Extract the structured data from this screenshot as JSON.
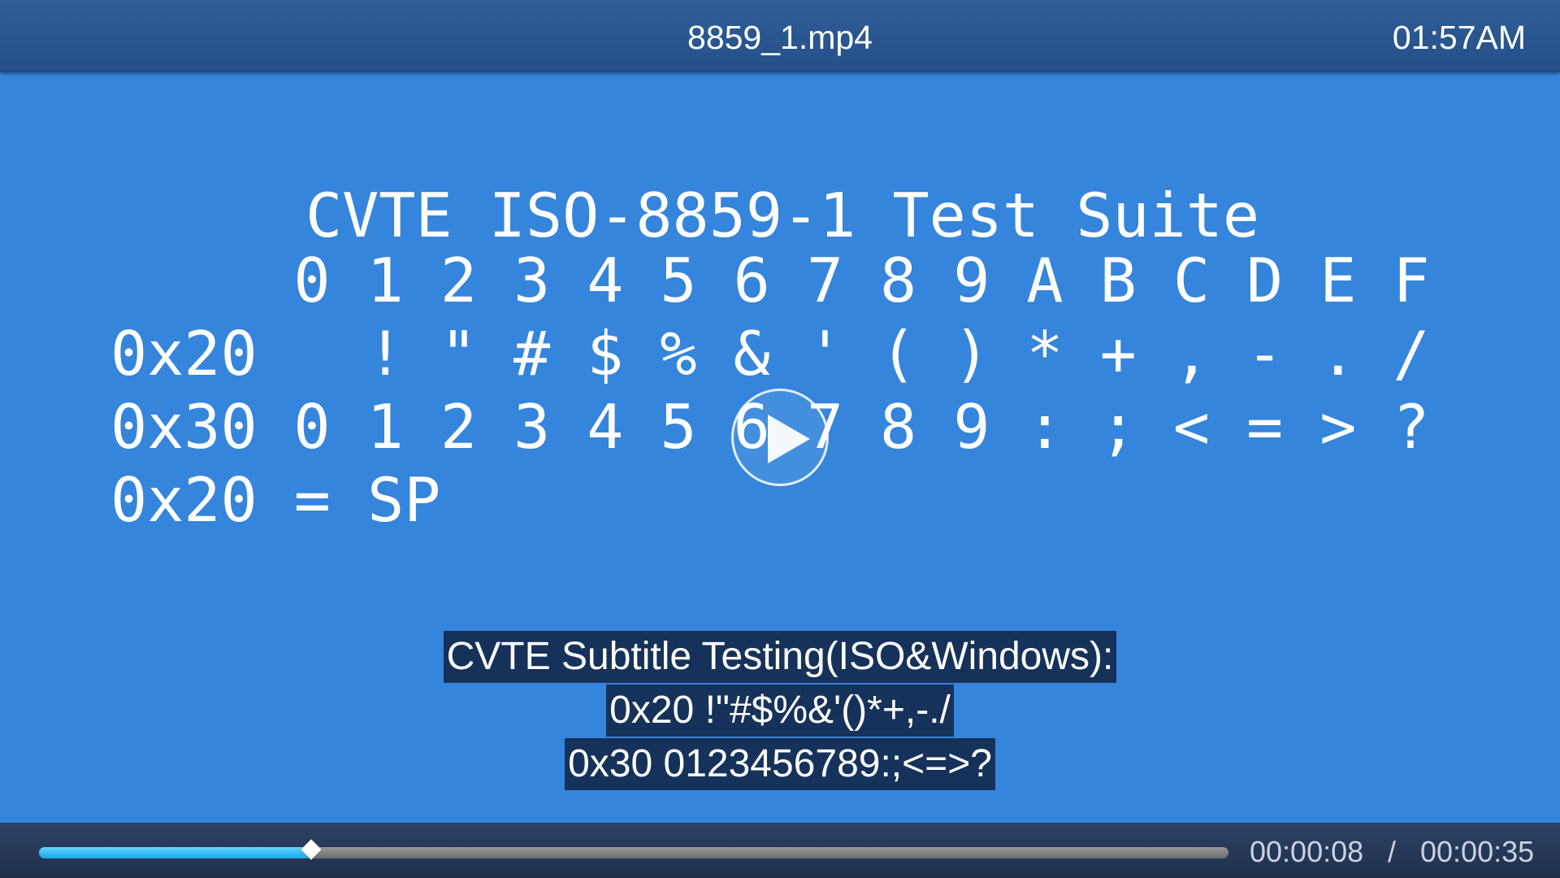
{
  "player": {
    "file_title": "8859_1.mp4",
    "clock": "01:57AM"
  },
  "video_frame": {
    "heading": "CVTE ISO-8859-1 Test Suite",
    "column_headers": [
      "0",
      "1",
      "2",
      "3",
      "4",
      "5",
      "6",
      "7",
      "8",
      "9",
      "A",
      "B",
      "C",
      "D",
      "E",
      "F"
    ],
    "rows": [
      {
        "label": "0x20",
        "cells": [
          " ",
          "!",
          "\"",
          "#",
          "$",
          "%",
          "&",
          "'",
          "(",
          ")",
          "*",
          "+",
          ",",
          "-",
          ".",
          "/"
        ]
      },
      {
        "label": "0x30",
        "cells": [
          "0",
          "1",
          "2",
          "3",
          "4",
          "5",
          "6",
          "7",
          "8",
          "9",
          ":",
          ";",
          "<",
          "=",
          ">",
          "?"
        ]
      }
    ],
    "note": "0x20 = SP"
  },
  "subtitles": [
    "CVTE Subtitle Testing(ISO&Windows):",
    "0x20 !\"#$%&'()*+,-./",
    "0x30 0123456789:;<=>?"
  ],
  "controls": {
    "play_icon": "play-icon",
    "current_time": "00:00:08",
    "separator": "/",
    "total_time": "00:00:35",
    "progress_fraction": 0.2286,
    "progress_color": "#3cbdf3"
  }
}
